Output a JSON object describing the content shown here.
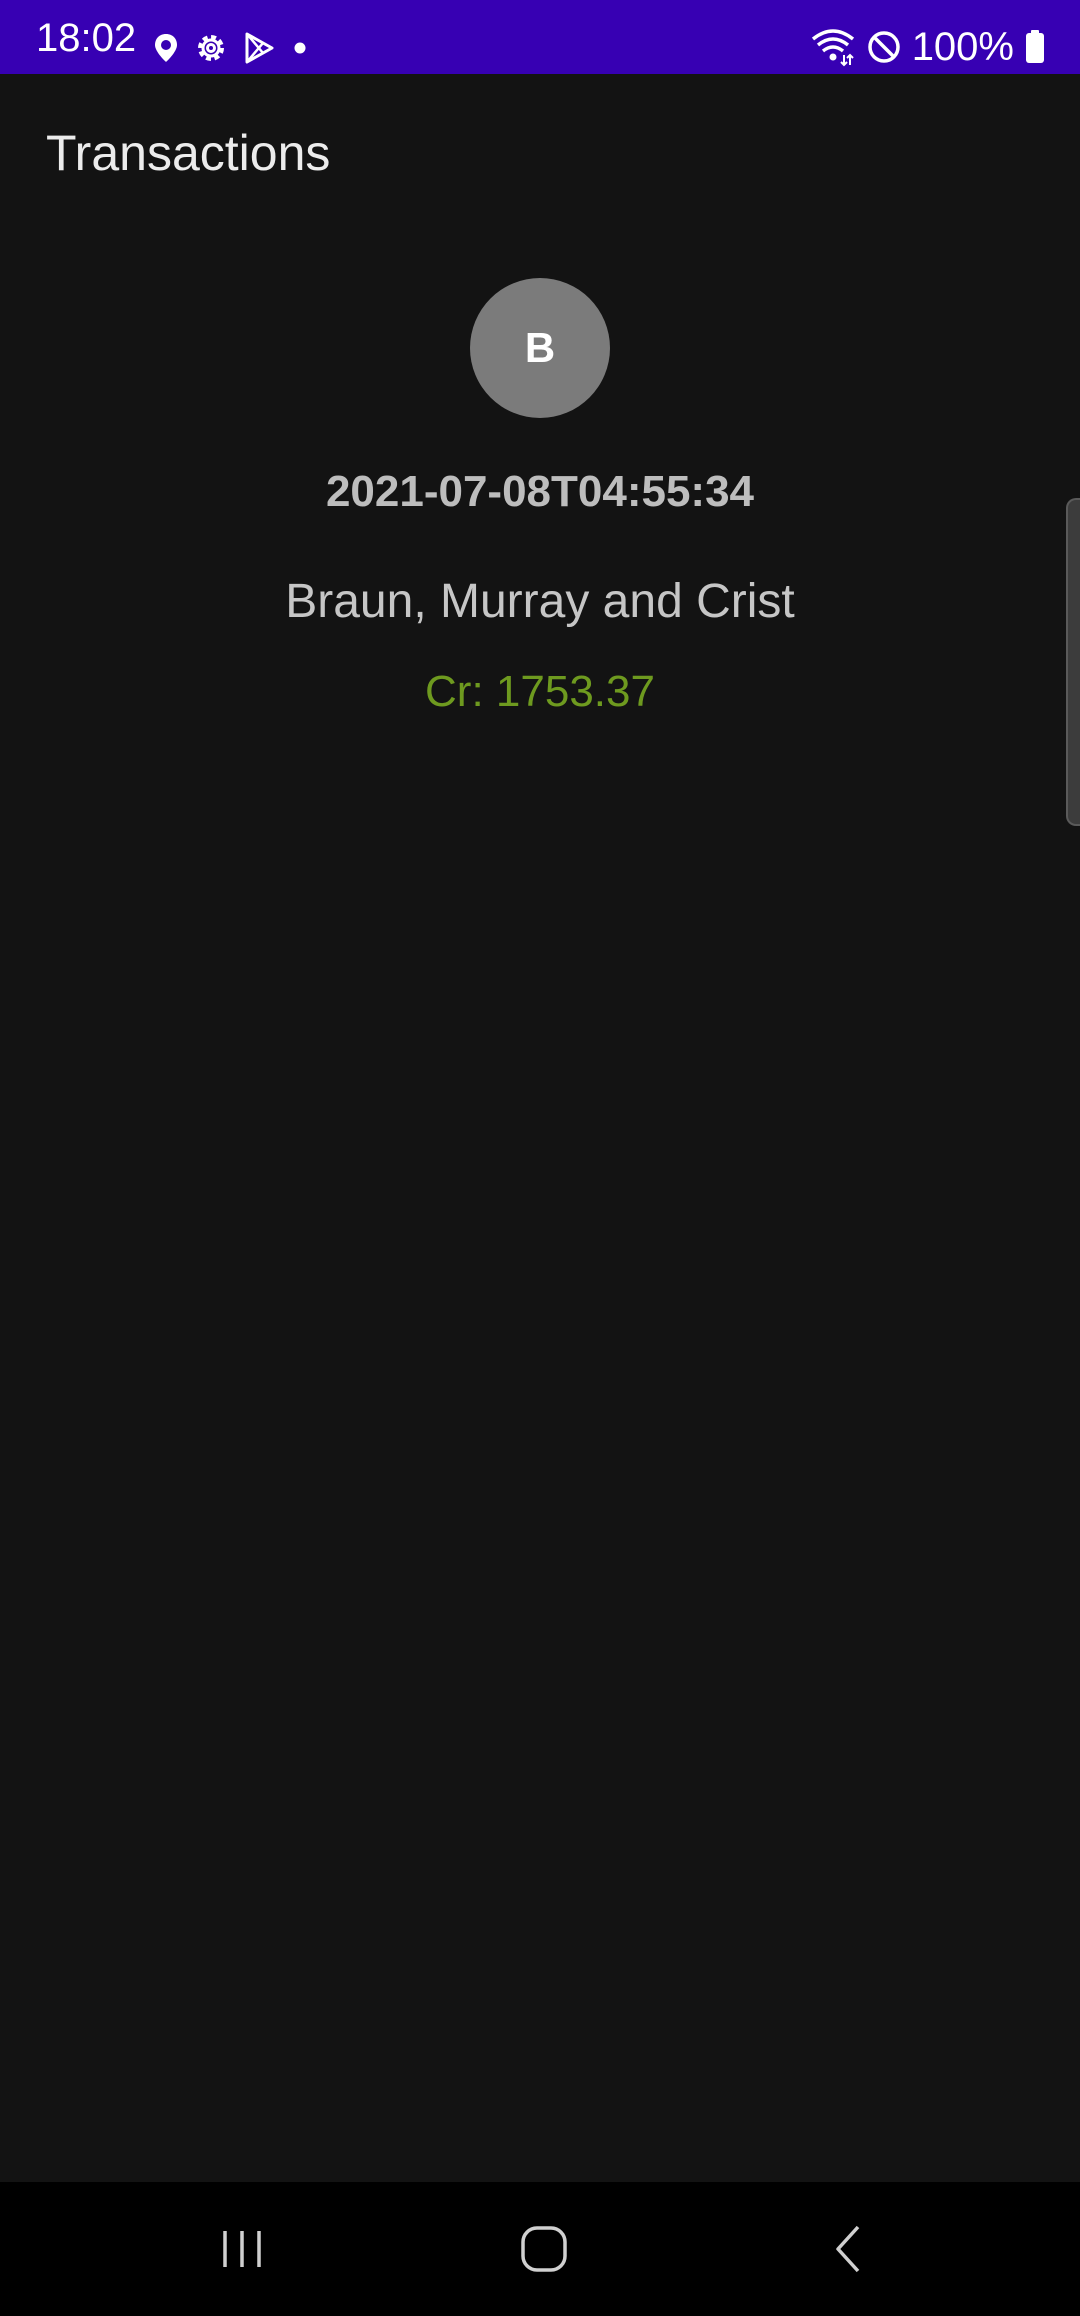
{
  "status_bar": {
    "time": "18:02",
    "left_icons": [
      "location-icon",
      "settings-icon",
      "play-store-icon",
      "dot-icon"
    ],
    "right_icons": [
      "wifi-icon",
      "do-not-disturb-icon",
      "battery-icon"
    ],
    "battery": "100%",
    "background_color": "#3700b3"
  },
  "app": {
    "title": "Transactions"
  },
  "transaction": {
    "avatar_letter": "B",
    "datetime": "2021-07-08T04:55:34",
    "name": "Braun, Murray and Crist",
    "amount": "Cr: 1753.37",
    "amount_color": "#6e9a1f"
  },
  "nav_bar": {
    "buttons": [
      "recents-icon",
      "home-icon",
      "back-icon"
    ]
  }
}
